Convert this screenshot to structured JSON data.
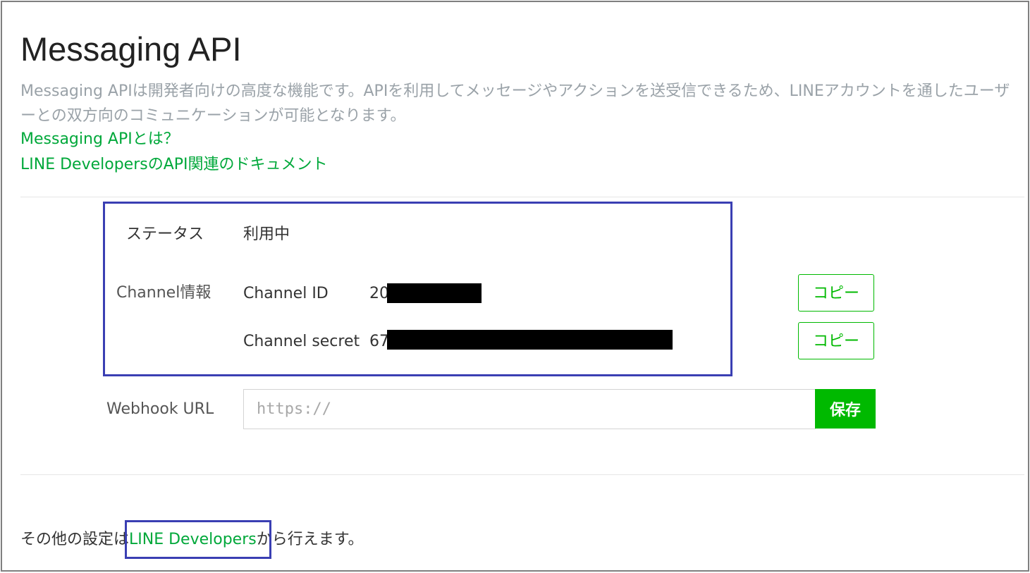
{
  "header": {
    "title": "Messaging API",
    "description": "Messaging APIは開発者向けの高度な機能です。APIを利用してメッセージやアクションを送受信できるため、LINEアカウントを通したユーザーとの双方向のコミュニケーションが可能となります。",
    "link_what": "Messaging APIとは？",
    "link_docs": "LINE DevelopersのAPI関連のドキュメント"
  },
  "status": {
    "label": "ステータス",
    "value": "利用中"
  },
  "channel": {
    "section_label": "Channel情報",
    "id_label": "Channel ID",
    "id_visible_prefix": "20",
    "secret_label": "Channel secret",
    "secret_visible_prefix": "67",
    "copy_label": "コピー"
  },
  "webhook": {
    "label": "Webhook URL",
    "placeholder": "https://",
    "save_label": "保存"
  },
  "footer": {
    "prefix": "その他の設定は",
    "link": "LINE Developers",
    "suffix": "から行えます。"
  },
  "colors": {
    "accent": "#00b900",
    "link": "#00a83a",
    "highlight_border": "#3a3fb3",
    "redaction": "#000000"
  }
}
